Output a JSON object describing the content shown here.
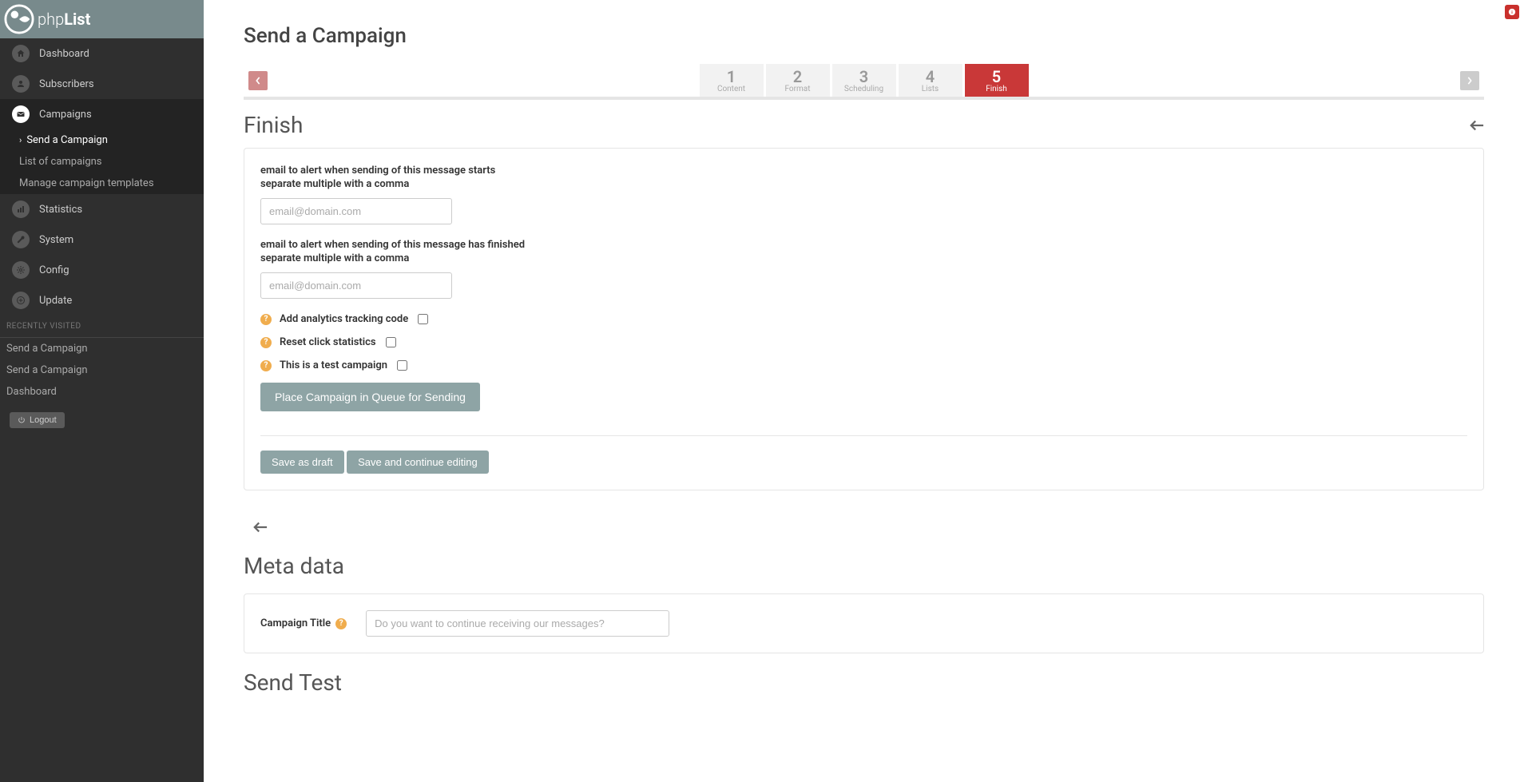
{
  "brand": {
    "name": "phpList"
  },
  "info_badge": true,
  "sidebar": {
    "items": [
      {
        "label": "Dashboard"
      },
      {
        "label": "Subscribers"
      },
      {
        "label": "Campaigns"
      },
      {
        "label": "Statistics"
      },
      {
        "label": "System"
      },
      {
        "label": "Config"
      },
      {
        "label": "Update"
      }
    ],
    "campaigns_sub": [
      {
        "label": "Send a Campaign"
      },
      {
        "label": "List of campaigns"
      },
      {
        "label": "Manage campaign templates"
      }
    ],
    "recent_header": "RECENTLY VISITED",
    "recent": [
      {
        "label": "Send a Campaign"
      },
      {
        "label": "Send a Campaign"
      },
      {
        "label": "Dashboard"
      }
    ],
    "logout": "Logout"
  },
  "page": {
    "title": "Send a Campaign",
    "steps": [
      {
        "num": "1",
        "label": "Content"
      },
      {
        "num": "2",
        "label": "Format"
      },
      {
        "num": "3",
        "label": "Scheduling"
      },
      {
        "num": "4",
        "label": "Lists"
      },
      {
        "num": "5",
        "label": "Finish"
      }
    ],
    "section_title": "Finish",
    "form": {
      "alert_start_l1": "email to alert when sending of this message starts",
      "alert_start_l2": "separate multiple with a comma",
      "alert_start_placeholder": "email@domain.com",
      "alert_start_value": "",
      "alert_finish_l1": "email to alert when sending of this message has finished",
      "alert_finish_l2": "separate multiple with a comma",
      "alert_finish_placeholder": "email@domain.com",
      "alert_finish_value": "",
      "analytics_label": "Add analytics tracking code",
      "reset_label": "Reset click statistics",
      "test_label": "This is a test campaign",
      "queue_button": "Place Campaign in Queue for Sending",
      "save_draft": "Save as draft",
      "save_continue": "Save and continue editing"
    },
    "meta": {
      "title": "Meta data",
      "field_label": "Campaign Title",
      "field_placeholder": "Do you want to continue receiving our messages?",
      "field_value": ""
    },
    "sendtest": {
      "title": "Send Test"
    }
  }
}
